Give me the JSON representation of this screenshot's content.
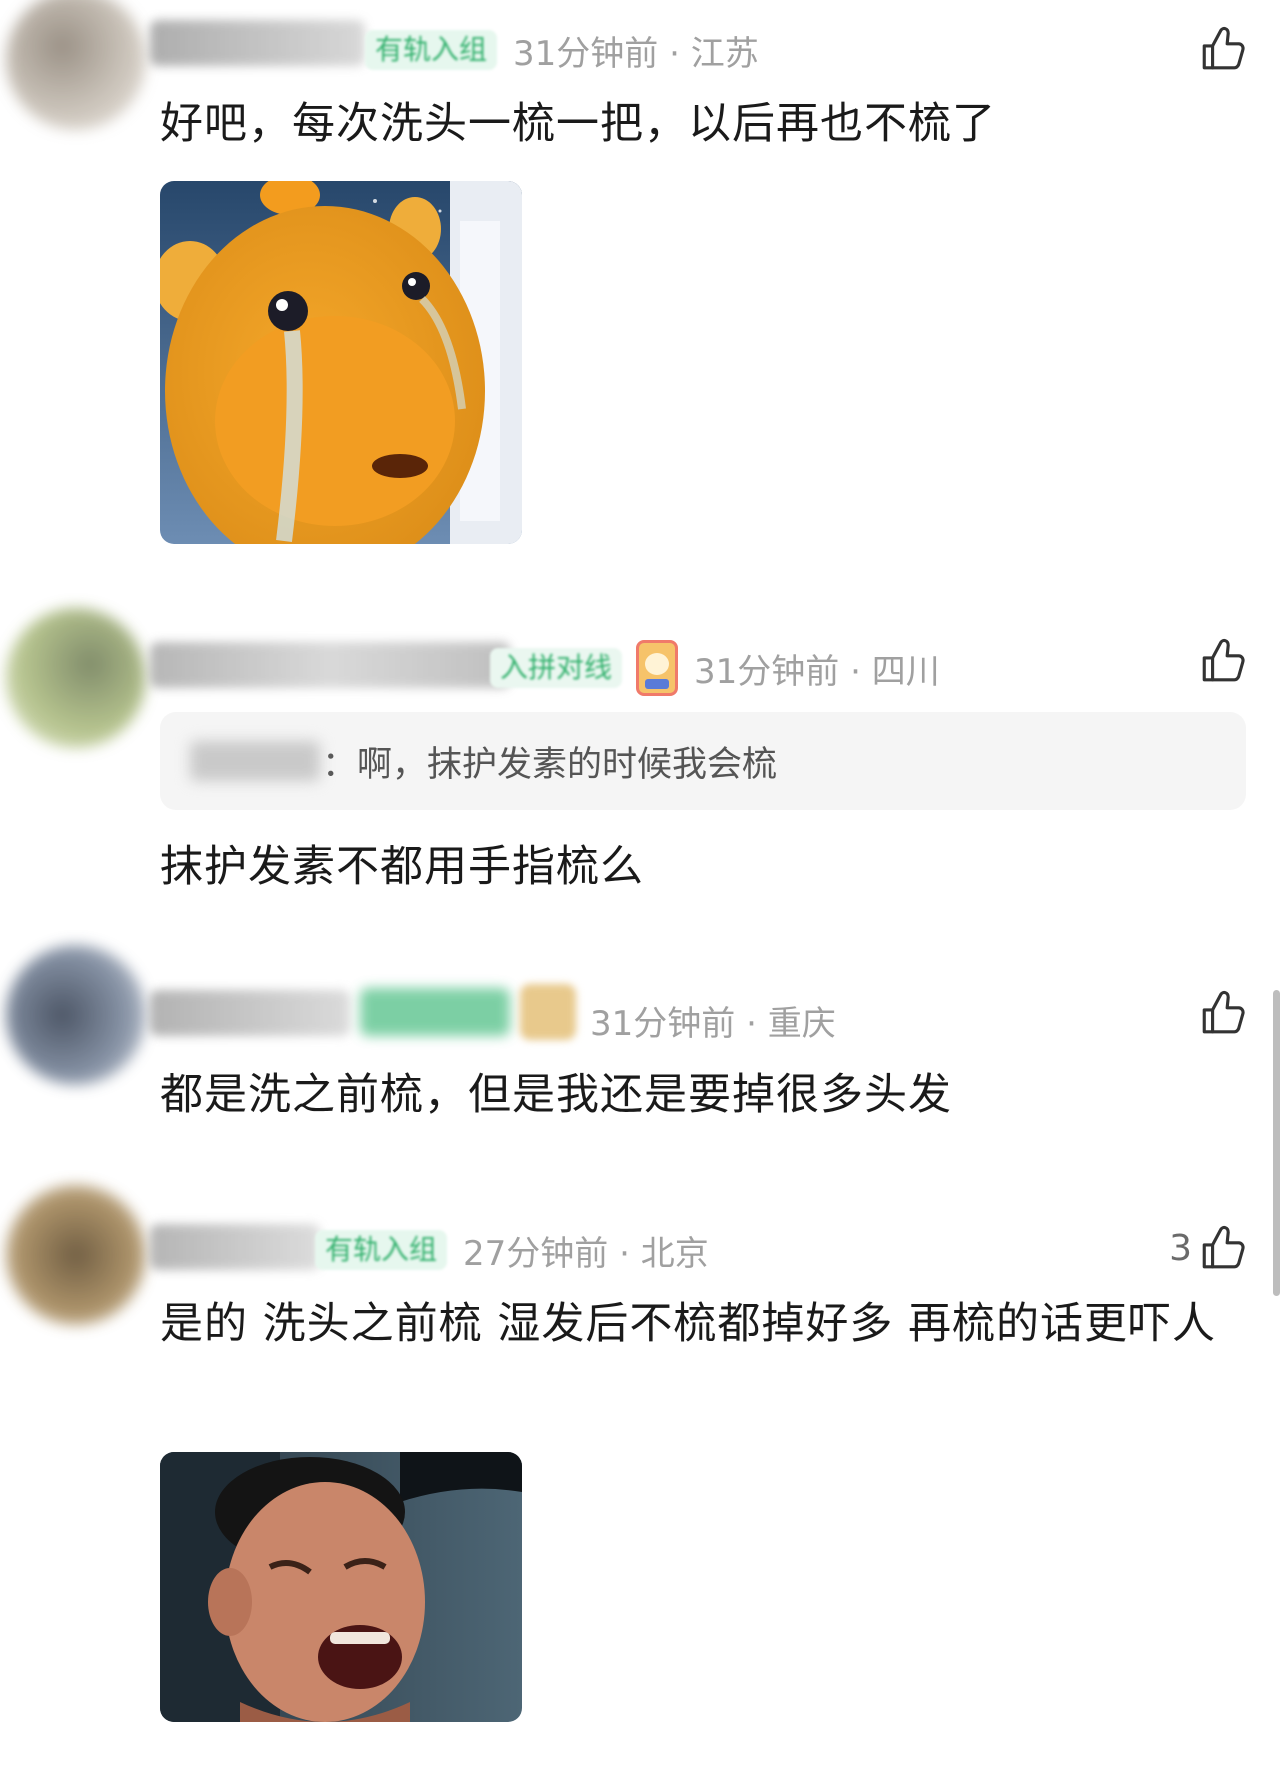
{
  "icons": {
    "like": "thumbs-up-icon"
  },
  "colors": {
    "badge_bg": "#e6f7ee",
    "badge_text": "#35b26f",
    "meta_text": "#a0a0a0"
  },
  "comments": [
    {
      "badge": "有轨入组",
      "time": "31分钟前",
      "separator": "·",
      "location": "江苏",
      "text": "好吧，每次洗头一梳一把，以后再也不梳了",
      "has_image": true,
      "image": "crying-cartoon-capybara-sticker"
    },
    {
      "badge": "入拼对线",
      "time": "31分钟前",
      "separator": "·",
      "location": "四川",
      "quote_text": "：啊，抹护发素的时候我会梳",
      "text": "抹护发素不都用手指梳么"
    },
    {
      "time": "31分钟前",
      "separator": "·",
      "location": "重庆",
      "text": "都是洗之前梳，但是我还是要掉很多头发"
    },
    {
      "badge": "有轨入组",
      "time": "27分钟前",
      "separator": "·",
      "location": "北京",
      "likes": "3",
      "text": "是的 洗头之前梳 湿发后不梳都掉好多 再梳的话更吓人",
      "has_image": true,
      "image": "crying-man-meme"
    }
  ]
}
